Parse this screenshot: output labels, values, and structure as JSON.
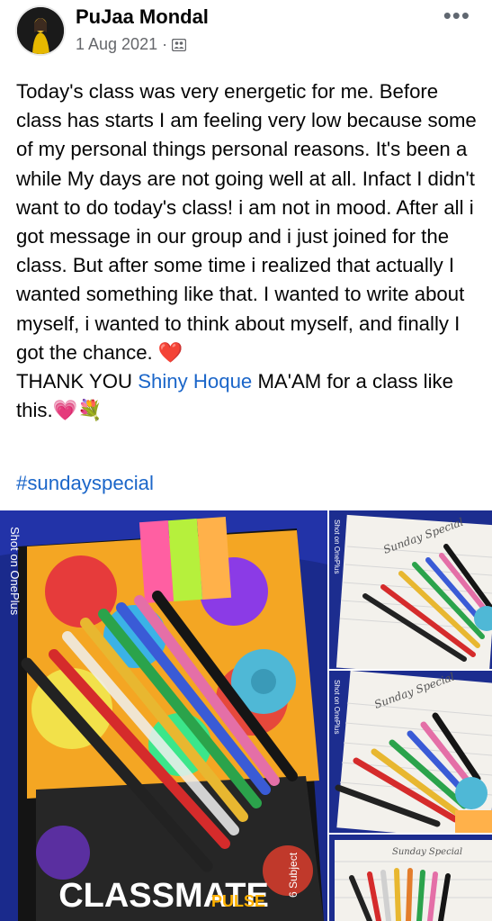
{
  "post": {
    "author": "PuJaa Mondal",
    "date": "1 Aug 2021",
    "separator": "·",
    "audience_icon": "friends-icon",
    "more_icon": "•••",
    "text_part1": "Today's class was very energetic for me. Before class has starts I am feeling very low because some of my personal things personal reasons. It's been a while My days are not going well at all. Infact I didn't want to do today's class! i am not in mood. After all i got message in our group and i just joined for the class. But after some time i realized that actually I wanted something like that. I wanted to write about myself, i wanted to think about myself, and finally I got the chance. ",
    "heart_emoji": "❤️",
    "text_part2": "THANK YOU ",
    "mention": "Shiny Hoque",
    "text_part3": " MA'AM for a class like this.",
    "emoji2": "💗💐",
    "hashtag": "#sundayspecial"
  },
  "photos": {
    "main_watermark": "Shot on OnePlus",
    "notebook_brand": "CLASSMATE",
    "notebook_line": "PULSE",
    "notebook_subject": "6 Subject",
    "side_watermark": "Shot on OnePlus",
    "side_caption": "Sunday Special"
  },
  "colors": {
    "link": "#1b66c9",
    "meta": "#65676b"
  }
}
